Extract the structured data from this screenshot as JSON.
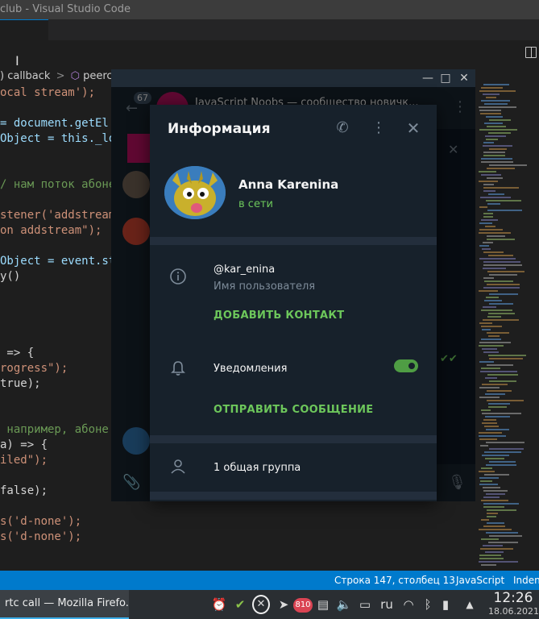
{
  "vscode": {
    "title": "club - Visual Studio Code",
    "breadcrumb": ") callback",
    "breadcrumb_sep": ">",
    "breadcrumb_item": "peercon",
    "code_lines": [
      "ocal stream');",
      "",
      "= document.getEl",
      "Object = this._lo",
      "",
      "",
      "/ нам поток абоне",
      "",
      "stener('addstream",
      "on addstream\");",
      "",
      "Object = event.st",
      "y()",
      "",
      "",
      "",
      "",
      " => {",
      "rogress\");",
      "true);",
      "",
      "",
      " например, абоне",
      "a) => {",
      "iled\");",
      "",
      "false);",
      "",
      "s('d-none');",
      "s('d-none');"
    ],
    "status": {
      "position": "Строка 147, столбец 13",
      "language": "JavaScript",
      "indent": "Inden"
    }
  },
  "taskbar": {
    "task": "rtc call — Mozilla Firefo...",
    "badge": "810",
    "lang": "ru",
    "time": "12:26",
    "date": "18.06.2021"
  },
  "telegram": {
    "unread": "67",
    "chat_title": "JavaScript Noobs — сообщество новичк...",
    "window_minimize": "—",
    "window_maximize": "□",
    "window_close": "✕"
  },
  "info_dialog": {
    "title": "Информация",
    "name": "Anna Karenina",
    "status": "в сети",
    "username": "@kar_enina",
    "username_label": "Имя пользователя",
    "add_contact": "ДОБАВИТЬ КОНТАКТ",
    "notifications": "Уведомления",
    "notifications_enabled": true,
    "send_message": "ОТПРАВИТЬ СООБЩЕНИЕ",
    "groups": "1 общая группа"
  }
}
